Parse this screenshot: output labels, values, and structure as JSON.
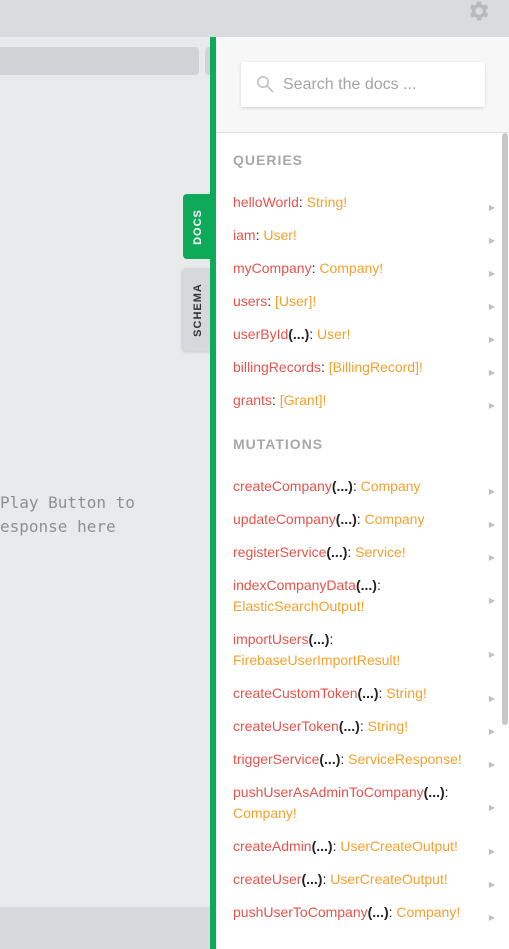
{
  "tabs": {
    "docs_label": "DOCS",
    "schema_label": "SCHEMA"
  },
  "result_pane": {
    "line1": "Play Button to",
    "line2": "esponse here"
  },
  "search": {
    "placeholder": "Search the docs ..."
  },
  "sections": {
    "queries_title": "QUERIES",
    "mutations_title": "MUTATIONS"
  },
  "queries": [
    {
      "name": "helloWorld",
      "args": "",
      "type": "String!"
    },
    {
      "name": "iam",
      "args": "",
      "type": "User!"
    },
    {
      "name": "myCompany",
      "args": "",
      "type": "Company!"
    },
    {
      "name": "users",
      "args": "",
      "type": "[User]!"
    },
    {
      "name": "userById",
      "args": "(...)",
      "type": "User!"
    },
    {
      "name": "billingRecords",
      "args": "",
      "type": "[BillingRecord]!"
    },
    {
      "name": "grants",
      "args": "",
      "type": "[Grant]!"
    }
  ],
  "mutations": [
    {
      "name": "createCompany",
      "args": "(...)",
      "type": "Company"
    },
    {
      "name": "updateCompany",
      "args": "(...)",
      "type": "Company"
    },
    {
      "name": "registerService",
      "args": "(...)",
      "type": "Service!"
    },
    {
      "name": "indexCompanyData",
      "args": "(...)",
      "type": "ElasticSearchOutput!"
    },
    {
      "name": "importUsers",
      "args": "(...)",
      "type": "FirebaseUserImportResult!"
    },
    {
      "name": "createCustomToken",
      "args": "(...)",
      "type": "String!"
    },
    {
      "name": "createUserToken",
      "args": "(...)",
      "type": "String!"
    },
    {
      "name": "triggerService",
      "args": "(...)",
      "type": "ServiceResponse!"
    },
    {
      "name": "pushUserAsAdminToCompany",
      "args": "(...)",
      "type": "Company!"
    },
    {
      "name": "createAdmin",
      "args": "(...)",
      "type": "UserCreateOutput!"
    },
    {
      "name": "createUser",
      "args": "(...)",
      "type": "UserCreateOutput!"
    },
    {
      "name": "pushUserToCompany",
      "args": "(...)",
      "type": "Company!"
    }
  ],
  "colors": {
    "accent": "#0faa59",
    "field_name": "#e5534b",
    "field_type": "#f5a02e"
  },
  "icons": {
    "settings": "gear-icon",
    "search": "search-icon",
    "expand": "triangle-right-icon"
  }
}
